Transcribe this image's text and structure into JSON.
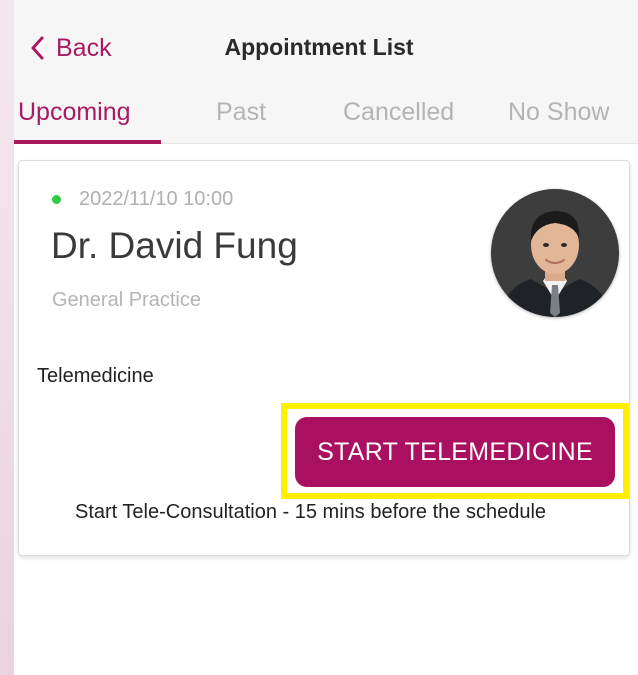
{
  "header": {
    "back_label": "Back",
    "title": "Appointment List"
  },
  "tabs": [
    {
      "label": "Upcoming",
      "active": true
    },
    {
      "label": "Past",
      "active": false
    },
    {
      "label": "Cancelled",
      "active": false
    },
    {
      "label": "No Show",
      "active": false
    }
  ],
  "appointment": {
    "datetime": "2022/11/10 10:00",
    "status_color": "#2ecc40",
    "doctor_name": "Dr. David Fung",
    "specialty": "General Practice",
    "type": "Telemedicine",
    "action_label": "START TELEMEDICINE",
    "hint": "Start Tele-Consultation - 15 mins before the schedule"
  },
  "colors": {
    "brand": "#a91a61",
    "button": "#a91060",
    "highlight": "#fff000"
  }
}
